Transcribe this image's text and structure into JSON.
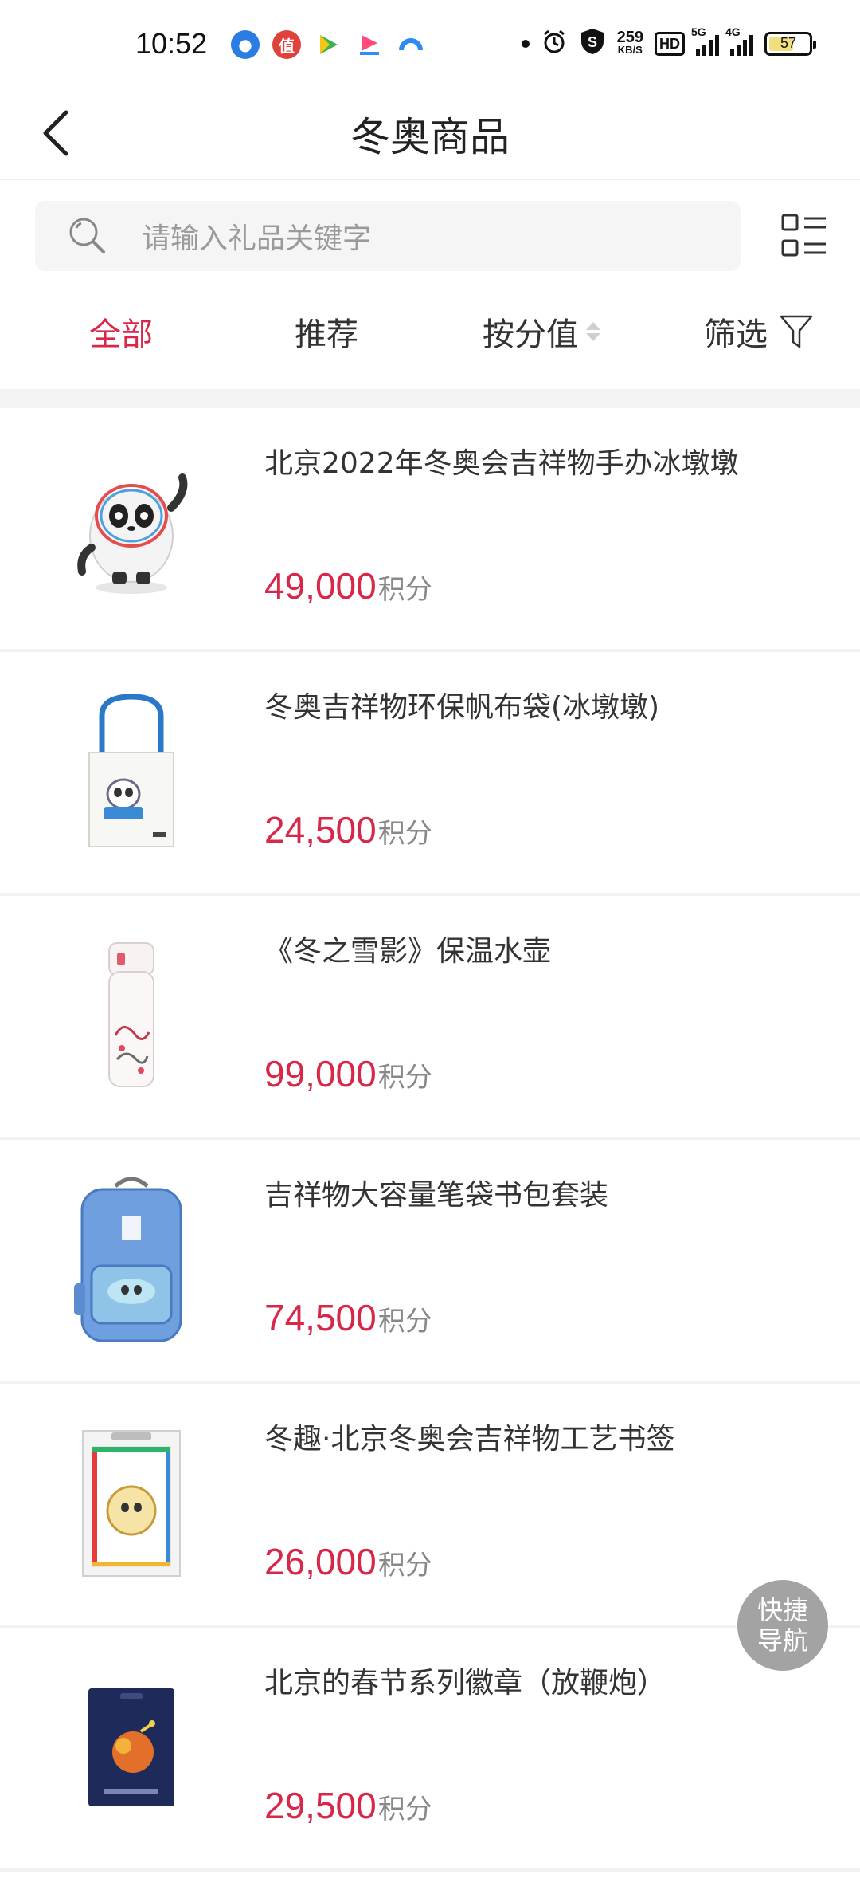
{
  "status_bar": {
    "time": "10:52",
    "net_speed_value": "259",
    "net_speed_unit": "KB/S",
    "hd_label": "HD",
    "signal1_label": "5G",
    "signal2_label": "4G",
    "battery_level": "57",
    "app_icons": [
      "circle-app-icon",
      "zhi-app-icon",
      "play-app-icon",
      "video-app-icon",
      "swirl-app-icon"
    ]
  },
  "header": {
    "title": "冬奥商品"
  },
  "search": {
    "placeholder": "请输入礼品关键字"
  },
  "tabs": [
    {
      "label": "全部",
      "active": true
    },
    {
      "label": "推荐",
      "active": false
    },
    {
      "label": "按分值",
      "active": false
    },
    {
      "label": "筛选",
      "active": false
    }
  ],
  "products": [
    {
      "name": "北京2022年冬奥会吉祥物手办冰墩墩",
      "price": "49,000",
      "unit": "积分",
      "image": "mascot-figure-image"
    },
    {
      "name": "冬奥吉祥物环保帆布袋(冰墩墩)",
      "price": "24,500",
      "unit": "积分",
      "image": "tote-bag-image"
    },
    {
      "name": "《冬之雪影》保温水壶",
      "price": "99,000",
      "unit": "积分",
      "image": "thermos-image"
    },
    {
      "name": "吉祥物大容量笔袋书包套装",
      "price": "74,500",
      "unit": "积分",
      "image": "backpack-image"
    },
    {
      "name": "冬趣·北京冬奥会吉祥物工艺书签",
      "price": "26,000",
      "unit": "积分",
      "image": "bookmark-image"
    },
    {
      "name": "北京的春节系列徽章（放鞭炮）",
      "price": "29,500",
      "unit": "积分",
      "image": "badge-image"
    }
  ],
  "quick_nav": {
    "line1": "快捷",
    "line2": "导航"
  },
  "colors": {
    "accent": "#d8284a",
    "muted": "#888888"
  }
}
